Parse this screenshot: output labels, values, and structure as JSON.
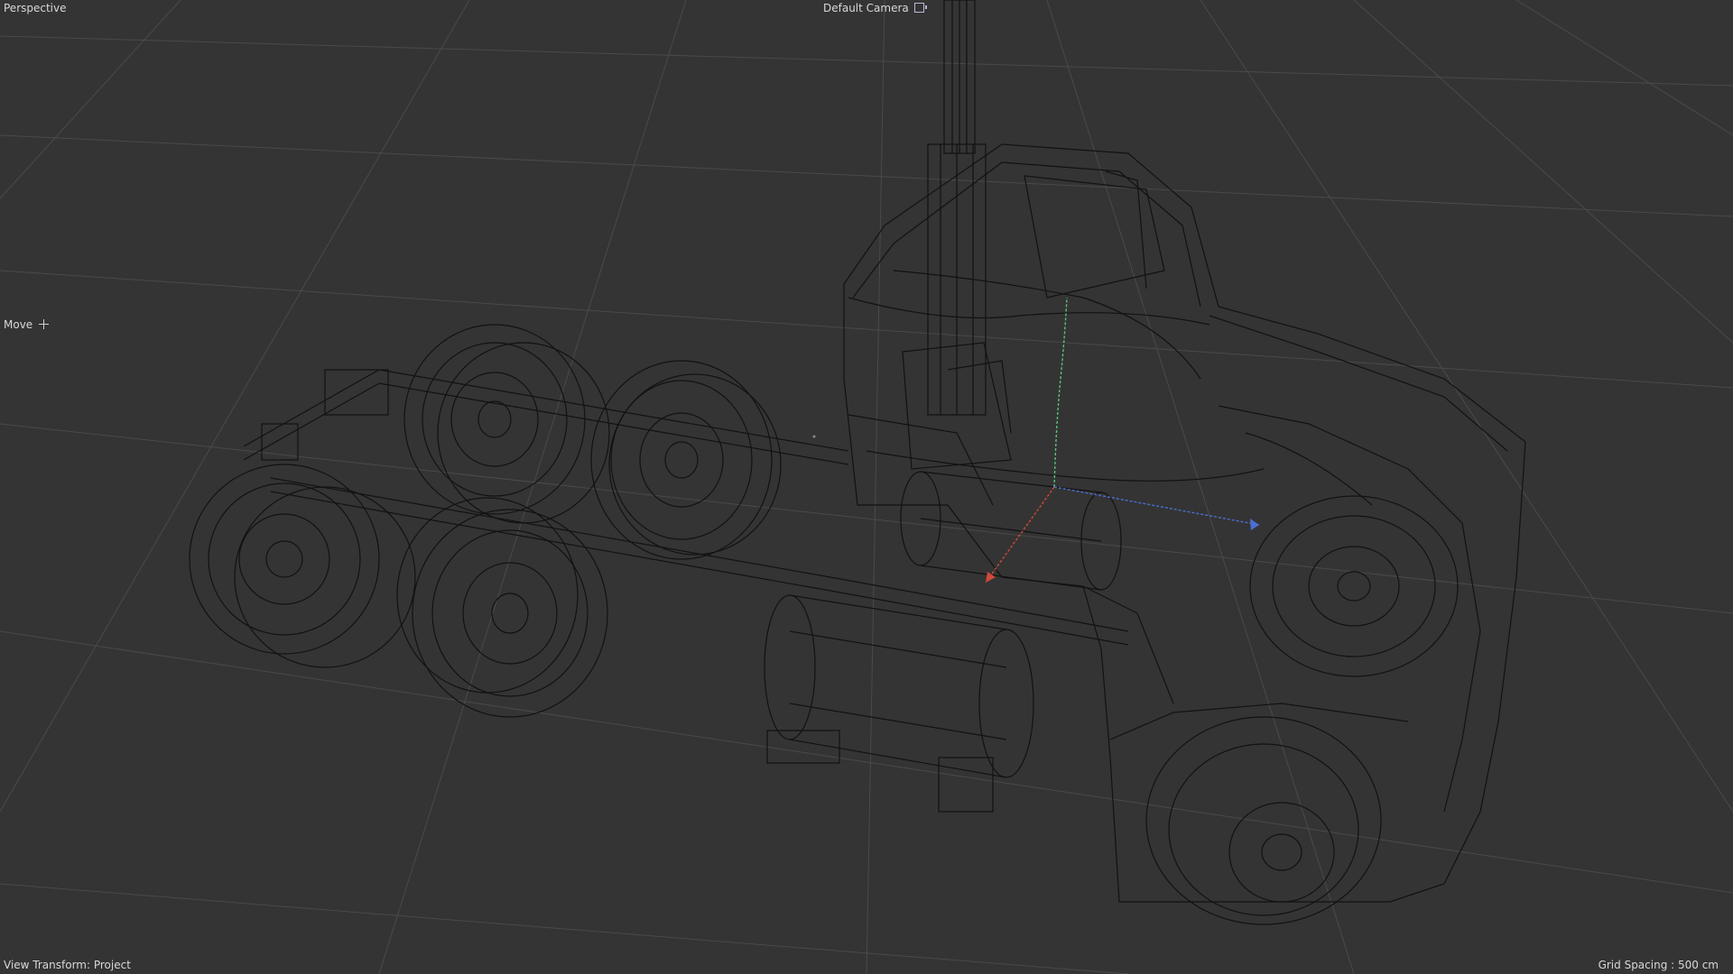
{
  "viewport": {
    "view_name": "Perspective",
    "camera": "Default Camera",
    "active_tool": "Move",
    "view_transform_label": "View Transform: Project",
    "grid_spacing_label": "Grid Spacing : 500 cm"
  },
  "icons": {
    "camera": "camera-icon",
    "tool": "move-icon"
  },
  "colors": {
    "background": "#343434",
    "grid": "#4a4a4a",
    "wire": "#111111",
    "axis_x": "#d04a3a",
    "axis_y": "#5ac27a",
    "axis_z": "#4a6fd0",
    "text": "#d8d8d8"
  }
}
